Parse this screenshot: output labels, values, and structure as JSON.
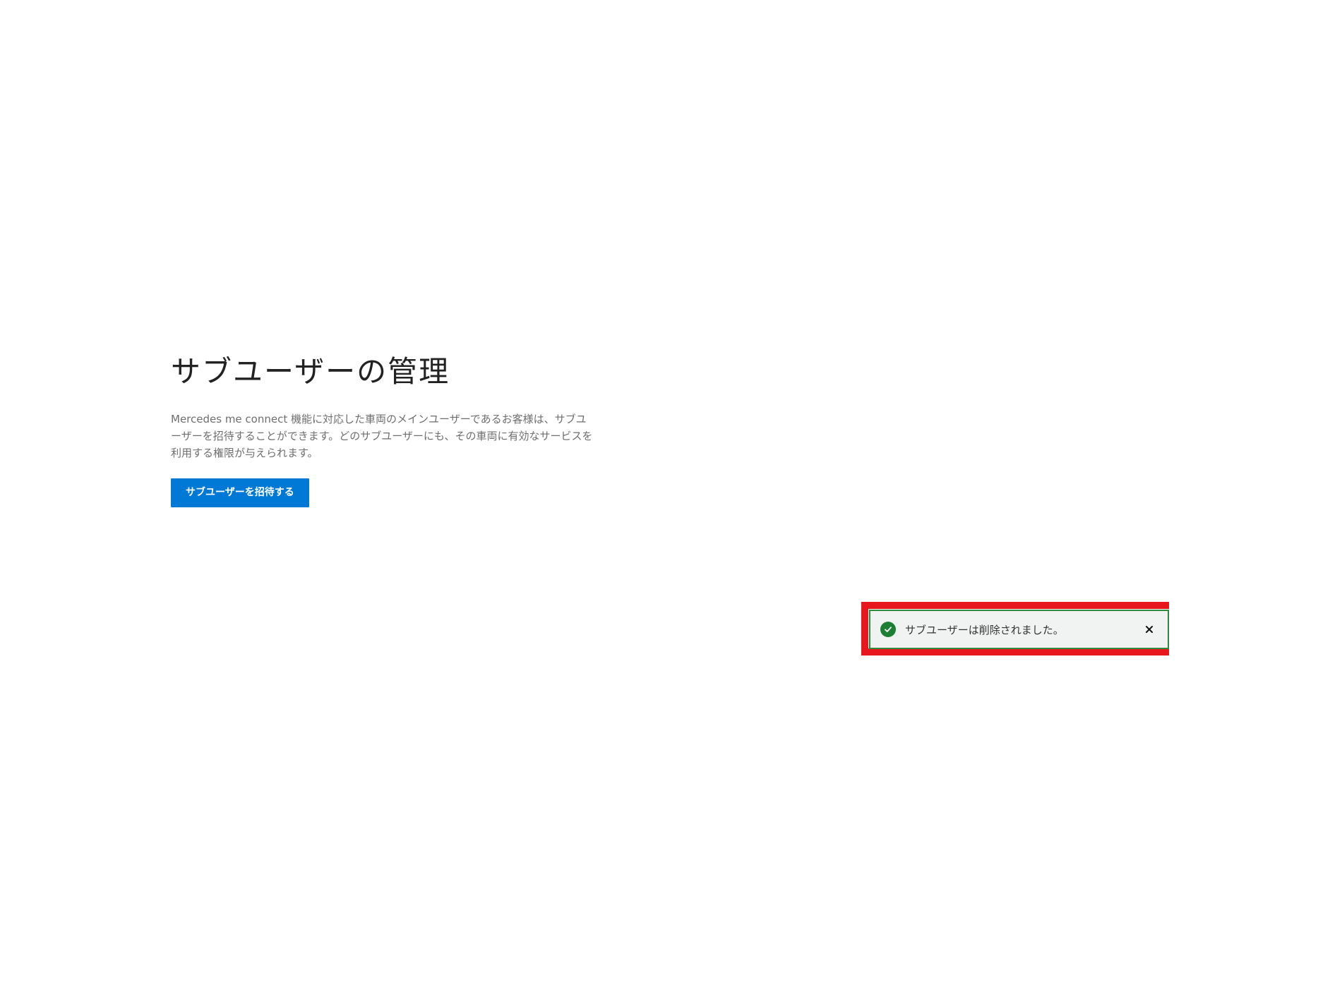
{
  "page": {
    "title": "サブユーザーの管理",
    "description": "Mercedes me connect 機能に対応した車両のメインユーザーであるお客様は、サブユーザーを招待することができます。どのサブユーザーにも、その車両に有効なサービスを利用する権限が与えられます。",
    "invite_button_label": "サブユーザーを招待する"
  },
  "toast": {
    "status": "success",
    "icon": "check-circle-icon",
    "message": "サブユーザーは削除されました。",
    "close_icon": "close-icon"
  },
  "colors": {
    "accent": "#0078d6",
    "success": "#1d7f33",
    "highlight": "#e8161d"
  }
}
